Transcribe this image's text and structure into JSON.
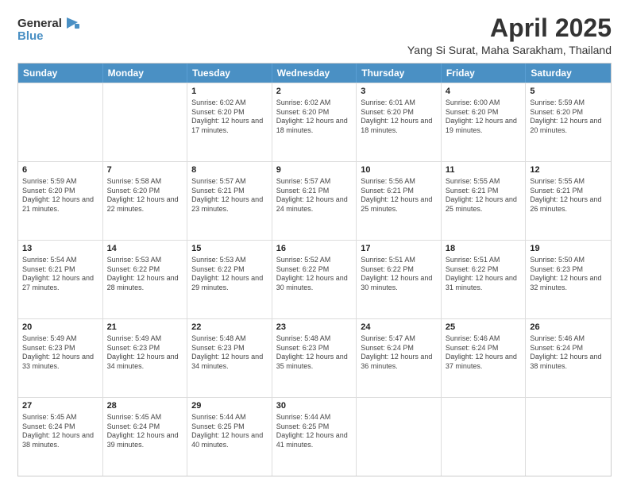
{
  "header": {
    "logo_line1": "General",
    "logo_line2": "Blue",
    "month": "April 2025",
    "location": "Yang Si Surat, Maha Sarakham, Thailand"
  },
  "weekdays": [
    "Sunday",
    "Monday",
    "Tuesday",
    "Wednesday",
    "Thursday",
    "Friday",
    "Saturday"
  ],
  "rows": [
    [
      {
        "day": "",
        "sunrise": "",
        "sunset": "",
        "daylight": ""
      },
      {
        "day": "",
        "sunrise": "",
        "sunset": "",
        "daylight": ""
      },
      {
        "day": "1",
        "sunrise": "Sunrise: 6:02 AM",
        "sunset": "Sunset: 6:20 PM",
        "daylight": "Daylight: 12 hours and 17 minutes."
      },
      {
        "day": "2",
        "sunrise": "Sunrise: 6:02 AM",
        "sunset": "Sunset: 6:20 PM",
        "daylight": "Daylight: 12 hours and 18 minutes."
      },
      {
        "day": "3",
        "sunrise": "Sunrise: 6:01 AM",
        "sunset": "Sunset: 6:20 PM",
        "daylight": "Daylight: 12 hours and 18 minutes."
      },
      {
        "day": "4",
        "sunrise": "Sunrise: 6:00 AM",
        "sunset": "Sunset: 6:20 PM",
        "daylight": "Daylight: 12 hours and 19 minutes."
      },
      {
        "day": "5",
        "sunrise": "Sunrise: 5:59 AM",
        "sunset": "Sunset: 6:20 PM",
        "daylight": "Daylight: 12 hours and 20 minutes."
      }
    ],
    [
      {
        "day": "6",
        "sunrise": "Sunrise: 5:59 AM",
        "sunset": "Sunset: 6:20 PM",
        "daylight": "Daylight: 12 hours and 21 minutes."
      },
      {
        "day": "7",
        "sunrise": "Sunrise: 5:58 AM",
        "sunset": "Sunset: 6:20 PM",
        "daylight": "Daylight: 12 hours and 22 minutes."
      },
      {
        "day": "8",
        "sunrise": "Sunrise: 5:57 AM",
        "sunset": "Sunset: 6:21 PM",
        "daylight": "Daylight: 12 hours and 23 minutes."
      },
      {
        "day": "9",
        "sunrise": "Sunrise: 5:57 AM",
        "sunset": "Sunset: 6:21 PM",
        "daylight": "Daylight: 12 hours and 24 minutes."
      },
      {
        "day": "10",
        "sunrise": "Sunrise: 5:56 AM",
        "sunset": "Sunset: 6:21 PM",
        "daylight": "Daylight: 12 hours and 25 minutes."
      },
      {
        "day": "11",
        "sunrise": "Sunrise: 5:55 AM",
        "sunset": "Sunset: 6:21 PM",
        "daylight": "Daylight: 12 hours and 25 minutes."
      },
      {
        "day": "12",
        "sunrise": "Sunrise: 5:55 AM",
        "sunset": "Sunset: 6:21 PM",
        "daylight": "Daylight: 12 hours and 26 minutes."
      }
    ],
    [
      {
        "day": "13",
        "sunrise": "Sunrise: 5:54 AM",
        "sunset": "Sunset: 6:21 PM",
        "daylight": "Daylight: 12 hours and 27 minutes."
      },
      {
        "day": "14",
        "sunrise": "Sunrise: 5:53 AM",
        "sunset": "Sunset: 6:22 PM",
        "daylight": "Daylight: 12 hours and 28 minutes."
      },
      {
        "day": "15",
        "sunrise": "Sunrise: 5:53 AM",
        "sunset": "Sunset: 6:22 PM",
        "daylight": "Daylight: 12 hours and 29 minutes."
      },
      {
        "day": "16",
        "sunrise": "Sunrise: 5:52 AM",
        "sunset": "Sunset: 6:22 PM",
        "daylight": "Daylight: 12 hours and 30 minutes."
      },
      {
        "day": "17",
        "sunrise": "Sunrise: 5:51 AM",
        "sunset": "Sunset: 6:22 PM",
        "daylight": "Daylight: 12 hours and 30 minutes."
      },
      {
        "day": "18",
        "sunrise": "Sunrise: 5:51 AM",
        "sunset": "Sunset: 6:22 PM",
        "daylight": "Daylight: 12 hours and 31 minutes."
      },
      {
        "day": "19",
        "sunrise": "Sunrise: 5:50 AM",
        "sunset": "Sunset: 6:23 PM",
        "daylight": "Daylight: 12 hours and 32 minutes."
      }
    ],
    [
      {
        "day": "20",
        "sunrise": "Sunrise: 5:49 AM",
        "sunset": "Sunset: 6:23 PM",
        "daylight": "Daylight: 12 hours and 33 minutes."
      },
      {
        "day": "21",
        "sunrise": "Sunrise: 5:49 AM",
        "sunset": "Sunset: 6:23 PM",
        "daylight": "Daylight: 12 hours and 34 minutes."
      },
      {
        "day": "22",
        "sunrise": "Sunrise: 5:48 AM",
        "sunset": "Sunset: 6:23 PM",
        "daylight": "Daylight: 12 hours and 34 minutes."
      },
      {
        "day": "23",
        "sunrise": "Sunrise: 5:48 AM",
        "sunset": "Sunset: 6:23 PM",
        "daylight": "Daylight: 12 hours and 35 minutes."
      },
      {
        "day": "24",
        "sunrise": "Sunrise: 5:47 AM",
        "sunset": "Sunset: 6:24 PM",
        "daylight": "Daylight: 12 hours and 36 minutes."
      },
      {
        "day": "25",
        "sunrise": "Sunrise: 5:46 AM",
        "sunset": "Sunset: 6:24 PM",
        "daylight": "Daylight: 12 hours and 37 minutes."
      },
      {
        "day": "26",
        "sunrise": "Sunrise: 5:46 AM",
        "sunset": "Sunset: 6:24 PM",
        "daylight": "Daylight: 12 hours and 38 minutes."
      }
    ],
    [
      {
        "day": "27",
        "sunrise": "Sunrise: 5:45 AM",
        "sunset": "Sunset: 6:24 PM",
        "daylight": "Daylight: 12 hours and 38 minutes."
      },
      {
        "day": "28",
        "sunrise": "Sunrise: 5:45 AM",
        "sunset": "Sunset: 6:24 PM",
        "daylight": "Daylight: 12 hours and 39 minutes."
      },
      {
        "day": "29",
        "sunrise": "Sunrise: 5:44 AM",
        "sunset": "Sunset: 6:25 PM",
        "daylight": "Daylight: 12 hours and 40 minutes."
      },
      {
        "day": "30",
        "sunrise": "Sunrise: 5:44 AM",
        "sunset": "Sunset: 6:25 PM",
        "daylight": "Daylight: 12 hours and 41 minutes."
      },
      {
        "day": "",
        "sunrise": "",
        "sunset": "",
        "daylight": ""
      },
      {
        "day": "",
        "sunrise": "",
        "sunset": "",
        "daylight": ""
      },
      {
        "day": "",
        "sunrise": "",
        "sunset": "",
        "daylight": ""
      }
    ]
  ]
}
